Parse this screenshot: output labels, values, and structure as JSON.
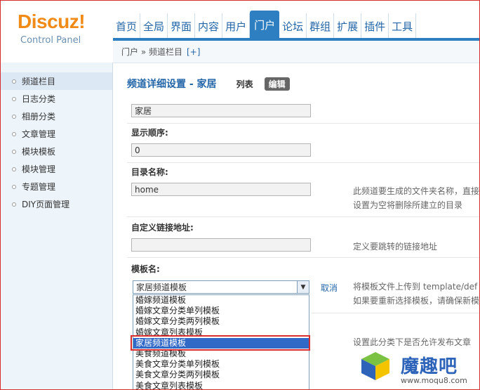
{
  "header": {
    "brand": "Discuz!",
    "sub": "Control Panel",
    "nav": [
      "首页",
      "全局",
      "界面",
      "内容",
      "用户",
      "门户",
      "论坛",
      "群组",
      "扩展",
      "插件",
      "工具"
    ],
    "active_nav": "门户"
  },
  "breadcrumb": {
    "path": "门户 » 频道栏目",
    "plus": "[+]"
  },
  "sidebar": {
    "items": [
      {
        "label": "频道栏目"
      },
      {
        "label": "日志分类"
      },
      {
        "label": "相册分类"
      },
      {
        "label": "文章管理"
      },
      {
        "label": "模块模板"
      },
      {
        "label": "模块管理"
      },
      {
        "label": "专题管理"
      },
      {
        "label": "DIY页面管理"
      }
    ]
  },
  "main": {
    "title": "频道详细设置 - 家居",
    "tab_list": "列表",
    "tab_edit": "编辑",
    "name_value": "家居",
    "order_label": "显示顺序:",
    "order_value": "0",
    "dir_label": "目录名称:",
    "dir_value": "home",
    "dir_hint_1": "此频道要生成的文件夹名称，直接",
    "dir_hint_2": "设置为空将删除所建立的目录",
    "link_label": "自定义链接地址:",
    "link_value": "",
    "link_hint": "定义要跳转的链接地址",
    "tpl_label": "模板名:",
    "tpl_selected": "家居频道模板",
    "cancel": "取消",
    "tpl_hint_1": "将模板文件上传到 template/def",
    "tpl_hint_2": "如果要重新选择模板，请确保新模",
    "publish_hint": "设置此分类下是否允许发布文章"
  },
  "dropdown": {
    "options": [
      "婚嫁频道模板",
      "婚嫁文章分类单列模板",
      "婚嫁文章分类两列模板",
      "婚嫁文章列表模板",
      "家居频道模板",
      "美食频道模板",
      "美食文章分类单列模板",
      "美食文章分类两列模板",
      "美食文章列表模板"
    ],
    "selected_index": 4
  },
  "watermark": {
    "name": "魔趣吧",
    "url": "www.moqu8.com"
  },
  "colors": {
    "accent": "#2d7fc1",
    "brand": "#f18a16",
    "highlight": "#d82d2d"
  }
}
